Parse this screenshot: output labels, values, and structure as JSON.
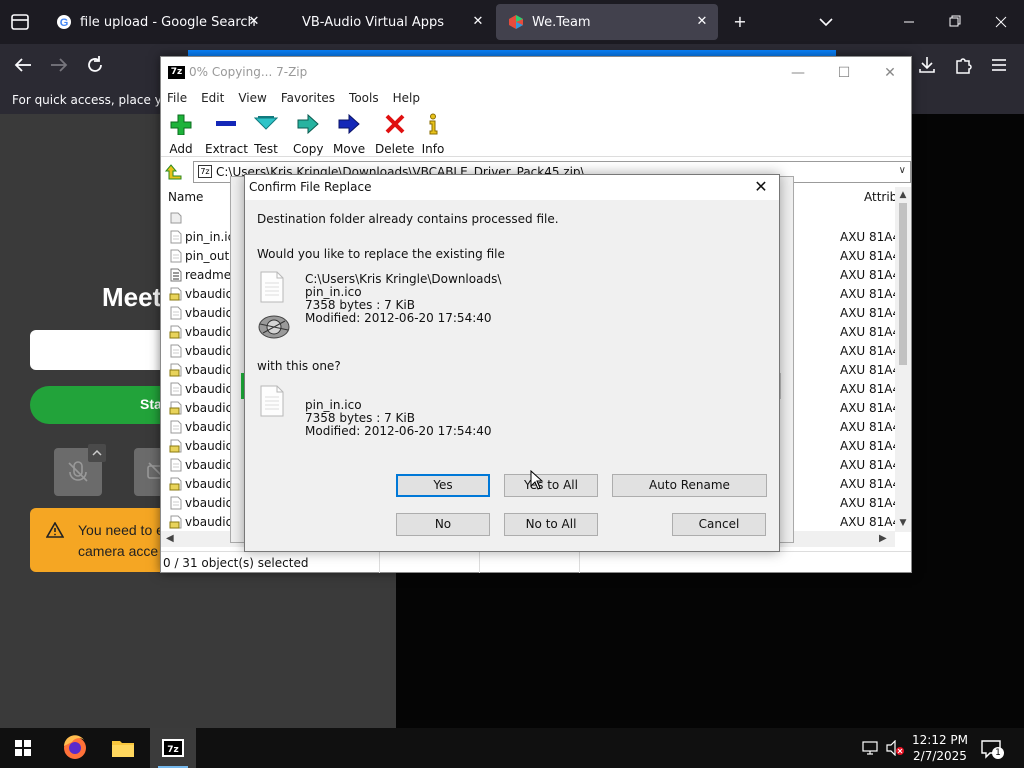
{
  "browser": {
    "tabs": [
      {
        "label": "file upload - Google Search",
        "favicon": "google-icon"
      },
      {
        "label": "VB-Audio Virtual Apps",
        "favicon": ""
      },
      {
        "label": "We.Team",
        "favicon": "weteam-icon",
        "active": true
      }
    ],
    "bookmarks_hint": "For quick access, place your"
  },
  "webpage": {
    "title": "Meet",
    "start_button": "Sta",
    "warning_line1": "You need to e",
    "warning_line2": "camera acce",
    "warning_color": "#f5a623",
    "start_color": "#22a33a"
  },
  "zip": {
    "title": "0% Copying... 7-Zip",
    "app_badge": "7z",
    "menu": [
      "File",
      "Edit",
      "View",
      "Favorites",
      "Tools",
      "Help"
    ],
    "toolbar": [
      {
        "label": "Add",
        "icon": "add-icon"
      },
      {
        "label": "Extract",
        "icon": "extract-icon"
      },
      {
        "label": "Test",
        "icon": "test-icon"
      },
      {
        "label": "Copy",
        "icon": "copy-icon"
      },
      {
        "label": "Move",
        "icon": "move-icon"
      },
      {
        "label": "Delete",
        "icon": "delete-icon"
      },
      {
        "label": "Info",
        "icon": "info-icon"
      }
    ],
    "path": "C:\\Users\\Kris Kringle\\Downloads\\VBCABLE_Driver_Pack45.zip\\",
    "columns": {
      "name": "Name",
      "attributes": "Attrib"
    },
    "files": [
      {
        "name": "",
        "type": "folder-up",
        "attr": ""
      },
      {
        "name": "pin_in.ico",
        "type": "file",
        "attr": "AXU 81A4"
      },
      {
        "name": "pin_out.i",
        "type": "file",
        "attr": "AXU 81A4"
      },
      {
        "name": "readme.t",
        "type": "text",
        "attr": "AXU 81A4"
      },
      {
        "name": "vbaudio_",
        "type": "inf",
        "attr": "AXU 81A4"
      },
      {
        "name": "vbaudio_",
        "type": "file",
        "attr": "AXU 81A4"
      },
      {
        "name": "vbaudio_",
        "type": "inf",
        "attr": "AXU 81A4"
      },
      {
        "name": "vbaudio_",
        "type": "file",
        "attr": "AXU 81A4"
      },
      {
        "name": "vbaudio_",
        "type": "inf",
        "attr": "AXU 81A4"
      },
      {
        "name": "vbaudio_",
        "type": "file",
        "attr": "AXU 81A4"
      },
      {
        "name": "vbaudio_",
        "type": "inf",
        "attr": "AXU 81A4"
      },
      {
        "name": "vbaudio_",
        "type": "file",
        "attr": "AXU 81A4"
      },
      {
        "name": "vbaudio_",
        "type": "inf",
        "attr": "AXU 81A4"
      },
      {
        "name": "vbaudio_",
        "type": "file",
        "attr": "AXU 81A4"
      },
      {
        "name": "vbaudio_",
        "type": "inf",
        "attr": "AXU 81A4"
      },
      {
        "name": "vbaudio_",
        "type": "file",
        "attr": "AXU 81A4"
      },
      {
        "name": "vbaudio_",
        "type": "inf",
        "attr": "AXU 81A4"
      }
    ],
    "status": "0 / 31 object(s) selected"
  },
  "confirm": {
    "title": "Confirm File Replace",
    "line1": "Destination folder already contains processed file.",
    "line2": "Would you like to replace the existing file",
    "existing": {
      "folder": "C:\\Users\\Kris Kringle\\Downloads\\",
      "name": "pin_in.ico",
      "size": "7358 bytes : 7 KiB",
      "modified": "Modified: 2012-06-20 17:54:40"
    },
    "with_label": "with this one?",
    "incoming": {
      "name": "pin_in.ico",
      "size": "7358 bytes : 7 KiB",
      "modified": "Modified: 2012-06-20 17:54:40"
    },
    "buttons": {
      "yes": "Yes",
      "yes_to_all": "Yes to All",
      "auto_rename": "Auto Rename",
      "no": "No",
      "no_to_all": "No to All",
      "cancel": "Cancel"
    }
  },
  "taskbar": {
    "time": "12:12 PM",
    "date": "2/7/2025",
    "notification_count": "1"
  }
}
